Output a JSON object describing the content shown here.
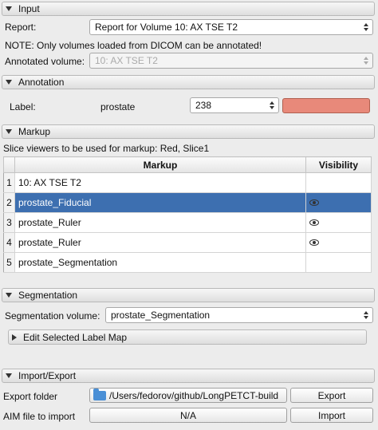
{
  "input": {
    "title": "Input",
    "report_label": "Report:",
    "report_value": "Report for Volume 10: AX TSE T2",
    "note": "NOTE: Only volumes loaded from DICOM can be annotated!",
    "annotated_label": "Annotated volume:",
    "annotated_value": "10: AX TSE T2"
  },
  "annotation": {
    "title": "Annotation",
    "label_caption": "Label:",
    "label_name": "prostate",
    "label_value": "238",
    "color": "#e8897a"
  },
  "markup": {
    "title": "Markup",
    "slice_viewers": "Slice viewers to be used for markup: Red, Slice1",
    "columns": [
      "Markup",
      "Visibility"
    ],
    "rows": [
      {
        "index": "1",
        "name": "10: AX TSE T2",
        "visible": false
      },
      {
        "index": "2",
        "name": "prostate_Fiducial",
        "visible": true
      },
      {
        "index": "3",
        "name": "prostate_Ruler",
        "visible": true
      },
      {
        "index": "4",
        "name": "prostate_Ruler",
        "visible": true
      },
      {
        "index": "5",
        "name": "prostate_Segmentation",
        "visible": false
      }
    ],
    "selected_row": 1
  },
  "segmentation": {
    "title": "Segmentation",
    "volume_label": "Segmentation volume:",
    "volume_value": "prostate_Segmentation",
    "edit_label": "Edit Selected Label Map"
  },
  "import_export": {
    "title": "Import/Export",
    "export_label": "Export folder",
    "export_path": "/Users/fedorov/github/LongPETCT-build",
    "export_button": "Export",
    "aim_label": "AIM file to import",
    "aim_value": "N/A",
    "import_button": "Import"
  }
}
